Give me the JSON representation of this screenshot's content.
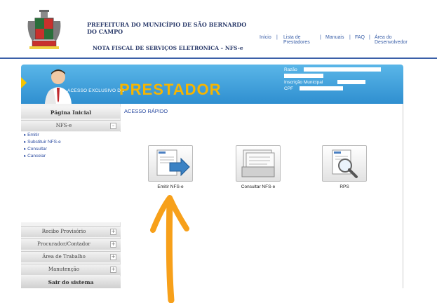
{
  "header": {
    "org_title": "PREFEITURA DO MUNICÍPIO DE SÃO BERNARDO DO CAMPO",
    "subtitle": "NOTA FISCAL DE SERVIÇOS ELETRONICA – NFS-e",
    "nav": {
      "inicio": "Início",
      "lista_line1": "Lista de",
      "lista_line2": "Prestadores",
      "manuais": "Manuais",
      "faq": "FAQ",
      "area_line1": "Área do",
      "area_line2": "Desenvolvedor",
      "separator": "|"
    }
  },
  "banner": {
    "acesso_exclusivo": "ACESSO EXCLUSIVO DO",
    "prestador": "PRESTADOR",
    "razao_label": "Razão",
    "inscricao_label": "Inscrição Municipal",
    "cpf_label": "CPF"
  },
  "sidebar": {
    "pagina_inicial": "Página Inicial",
    "nfse": "NFS-e",
    "nfse_toggle": "–",
    "items": [
      "Emitir",
      "Substituir NFS-e",
      "Consultar",
      "Cancelar"
    ],
    "bullet": "▸",
    "sections": [
      {
        "label": "Recibo Provisório",
        "toggle": "+"
      },
      {
        "label": "Procurador/Contador",
        "toggle": "+"
      },
      {
        "label": "Área de Trabalho",
        "toggle": "+"
      },
      {
        "label": "Manutenção",
        "toggle": "+"
      }
    ],
    "sair": "Sair do sistema"
  },
  "main": {
    "acesso_rapido": "ACESSO RÁPIDO",
    "tiles": [
      {
        "label": "Emitir NFS-e"
      },
      {
        "label": "Consultar NFS-e"
      },
      {
        "label": "RPS"
      }
    ]
  },
  "colors": {
    "banner_blue": "#2f8fd0",
    "prestador_yellow": "#f7b500",
    "annotation_orange": "#f7a01a"
  }
}
